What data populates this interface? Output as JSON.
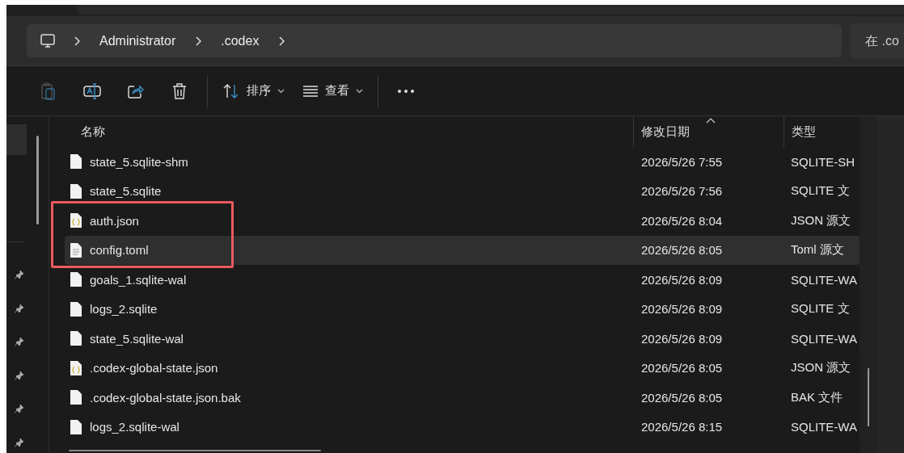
{
  "breadcrumb": {
    "items": [
      "Administrator",
      ".codex"
    ]
  },
  "search": {
    "placeholder": "在 .co"
  },
  "toolbar": [
    {
      "kind": "paste",
      "disabled": true
    },
    {
      "kind": "rename",
      "disabled": false
    },
    {
      "kind": "share",
      "disabled": false
    },
    {
      "kind": "delete",
      "disabled": false
    },
    {
      "kind": "sort",
      "label": "排序",
      "disabled": false
    },
    {
      "kind": "view",
      "label": "查看",
      "disabled": false
    },
    {
      "kind": "more",
      "disabled": false
    }
  ],
  "table": {
    "columns": [
      {
        "label": "名称",
        "sorted": false
      },
      {
        "label": "修改日期",
        "sorted": true
      },
      {
        "label": "类型",
        "sorted": false
      }
    ],
    "rows": [
      {
        "name": "state_5.sqlite-shm",
        "kind": "blank",
        "date": "2026/5/26 7:55",
        "type": "SQLITE-SH",
        "selected": false,
        "annotated": false
      },
      {
        "name": "state_5.sqlite",
        "kind": "blank",
        "date": "2026/5/26 7:56",
        "type": "SQLITE 文",
        "selected": false,
        "annotated": false
      },
      {
        "name": "auth.json",
        "kind": "json",
        "date": "2026/5/26 8:04",
        "type": "JSON 源文",
        "selected": false,
        "annotated": true
      },
      {
        "name": "config.toml",
        "kind": "text",
        "date": "2026/5/26 8:05",
        "type": "Toml 源文",
        "selected": true,
        "annotated": true
      },
      {
        "name": "goals_1.sqlite-wal",
        "kind": "blank",
        "date": "2026/5/26 8:09",
        "type": "SQLITE-WA",
        "selected": false,
        "annotated": false
      },
      {
        "name": "logs_2.sqlite",
        "kind": "blank",
        "date": "2026/5/26 8:09",
        "type": "SQLITE 文",
        "selected": false,
        "annotated": false
      },
      {
        "name": "state_5.sqlite-wal",
        "kind": "blank",
        "date": "2026/5/26 8:09",
        "type": "SQLITE-WA",
        "selected": false,
        "annotated": false
      },
      {
        "name": ".codex-global-state.json",
        "kind": "json",
        "date": "2026/5/26 8:05",
        "type": "JSON 源文",
        "selected": false,
        "annotated": false
      },
      {
        "name": ".codex-global-state.json.bak",
        "kind": "blank",
        "date": "2026/5/26 8:05",
        "type": "BAK 文件",
        "selected": false,
        "annotated": false
      },
      {
        "name": "logs_2.sqlite-wal",
        "kind": "blank",
        "date": "2026/5/26 8:15",
        "type": "SQLITE-WA",
        "selected": false,
        "annotated": false
      }
    ]
  }
}
